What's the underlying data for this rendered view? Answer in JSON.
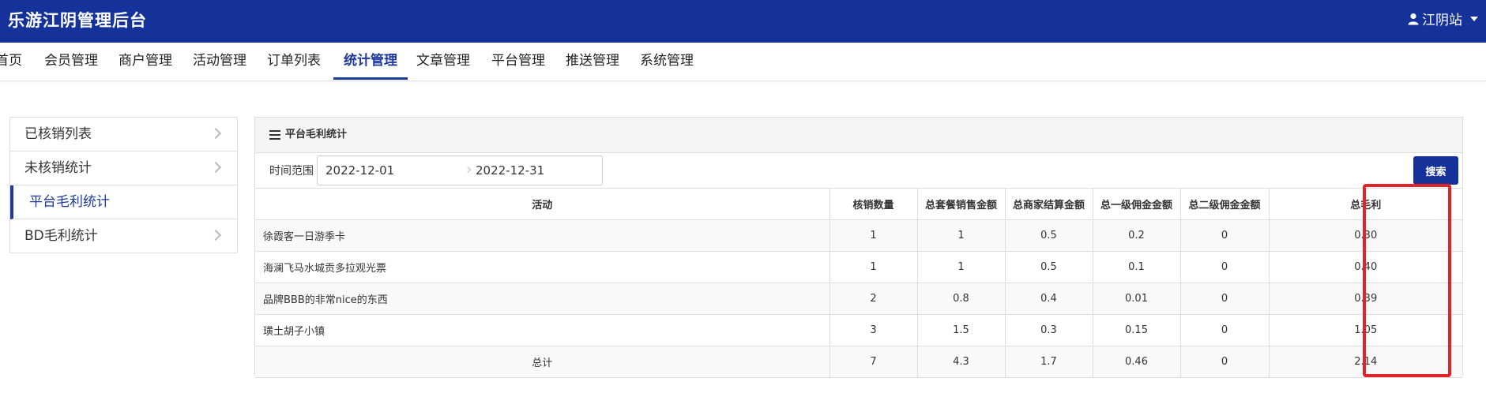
{
  "header": {
    "brand": "乐游江阴管理后台",
    "user_label": "江阴站",
    "user_icon": "user-icon"
  },
  "nav": {
    "items": [
      {
        "label": "首页"
      },
      {
        "label": "会员管理"
      },
      {
        "label": "商户管理"
      },
      {
        "label": "活动管理"
      },
      {
        "label": "订单列表"
      },
      {
        "label": "统计管理",
        "active": true
      },
      {
        "label": "文章管理"
      },
      {
        "label": "平台管理"
      },
      {
        "label": "推送管理"
      },
      {
        "label": "系统管理"
      }
    ]
  },
  "sidebar": {
    "items": [
      {
        "label": "已核销列表"
      },
      {
        "label": "未核销统计"
      },
      {
        "label": "平台毛利统计",
        "active": true
      },
      {
        "label": "BD毛利统计"
      }
    ]
  },
  "panel": {
    "title": "平台毛利统计",
    "title_icon": "list-icon",
    "filter": {
      "label": "时间范围",
      "start_date": "2022-12-01",
      "end_date": "2022-12-31",
      "search_label": "搜索"
    },
    "table": {
      "columns": [
        "活动",
        "核销数量",
        "总套餐销售金额",
        "总商家结算金额",
        "总一级佣金金额",
        "总二级佣金金额",
        "总毛利"
      ],
      "rows": [
        [
          "徐霞客一日游季卡",
          "1",
          "1",
          "0.5",
          "0.2",
          "0",
          "0.30"
        ],
        [
          "海澜飞马水城贡多拉观光票",
          "1",
          "1",
          "0.5",
          "0.1",
          "0",
          "0.40"
        ],
        [
          "品牌BBB的非常nice的东西",
          "2",
          "0.8",
          "0.4",
          "0.01",
          "0",
          "0.39"
        ],
        [
          "璜土胡子小镇",
          "3",
          "1.5",
          "0.3",
          "0.15",
          "0",
          "1.05"
        ]
      ],
      "total": [
        "总计",
        "7",
        "4.3",
        "1.7",
        "0.46",
        "0",
        "2.14"
      ]
    }
  },
  "colors": {
    "brand_blue": "#14329a",
    "highlight_red": "#e0252a"
  }
}
